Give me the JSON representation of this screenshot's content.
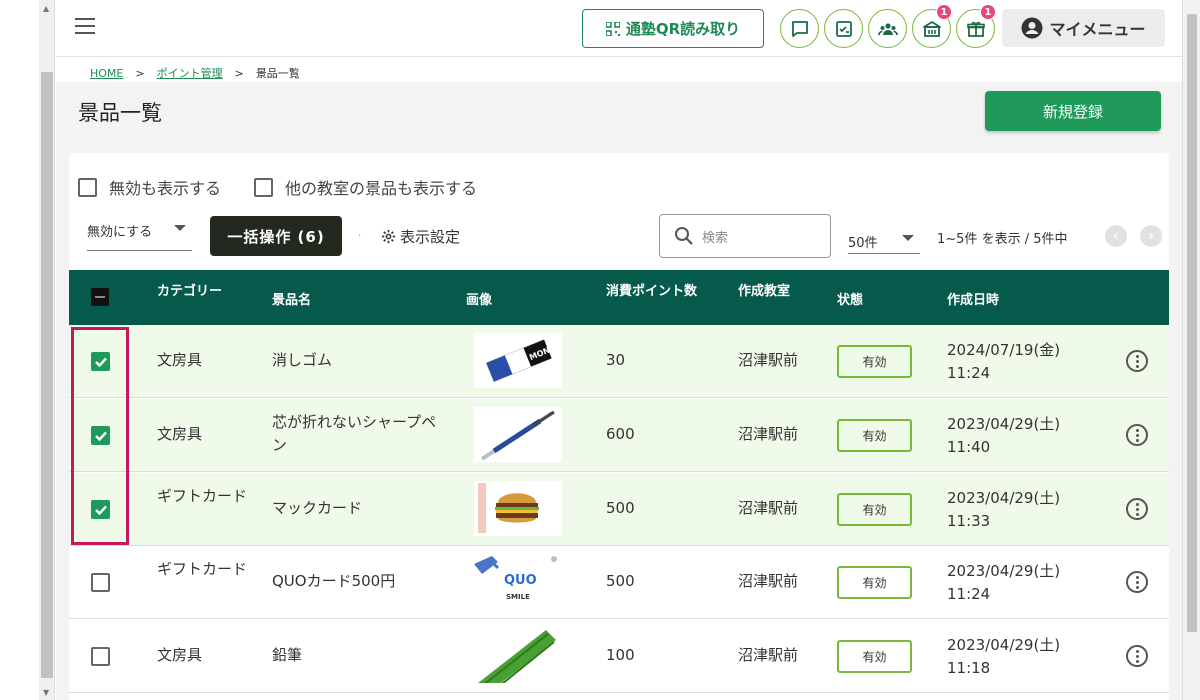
{
  "header": {
    "qr_label": "通塾QR読み取り",
    "mymenu_label": "マイメニュー",
    "badges": {
      "shop": "1",
      "gift": "1"
    }
  },
  "breadcrumb": {
    "home": "HOME",
    "sep": ">",
    "points": "ポイント管理",
    "current": "景品一覧"
  },
  "page": {
    "title": "景品一覧",
    "new_button": "新規登録"
  },
  "filters": {
    "show_disabled": "無効も表示する",
    "show_other": "他の教室の景品も表示する"
  },
  "toolbar": {
    "action_select": "無効にする",
    "bulk_label": "一括操作 (6)",
    "display_settings": "表示設定",
    "search_placeholder": "検索",
    "per_page": "50件",
    "range": "1~5件 を表示 / 5件中"
  },
  "table": {
    "headers": {
      "category": "カテゴリー",
      "name": "景品名",
      "image": "画像",
      "points": "消費ポイント数",
      "school": "作成教室",
      "status": "状態",
      "created": "作成日時"
    },
    "rows": [
      {
        "category": "文房具",
        "name": "消しゴム",
        "points": "30",
        "school": "沼津駅前",
        "status": "有効",
        "date": "2024/07/19(金)",
        "time": "11:24",
        "checked": true
      },
      {
        "category": "文房具",
        "name": "芯が折れないシャープペン",
        "points": "600",
        "school": "沼津駅前",
        "status": "有効",
        "date": "2023/04/29(土)",
        "time": "11:40",
        "checked": true
      },
      {
        "category": "ギフトカード",
        "name": "マックカード",
        "points": "500",
        "school": "沼津駅前",
        "status": "有効",
        "date": "2023/04/29(土)",
        "time": "11:33",
        "checked": true
      },
      {
        "category": "ギフトカード",
        "name": "QUOカード500円",
        "points": "500",
        "school": "沼津駅前",
        "status": "有効",
        "date": "2023/04/29(土)",
        "time": "11:24",
        "checked": false
      },
      {
        "category": "文房具",
        "name": "鉛筆",
        "points": "100",
        "school": "沼津駅前",
        "status": "有効",
        "date": "2023/04/29(土)",
        "time": "11:18",
        "checked": false
      }
    ]
  },
  "images": {
    "eraser_text": "MONO",
    "quo_text": "QUO",
    "quo_sub": "SMILE"
  },
  "colors": {
    "brand_green": "#1f9a5b",
    "header_teal": "#065a4c",
    "highlight": "#c4195d",
    "badge": "#e8467b"
  }
}
